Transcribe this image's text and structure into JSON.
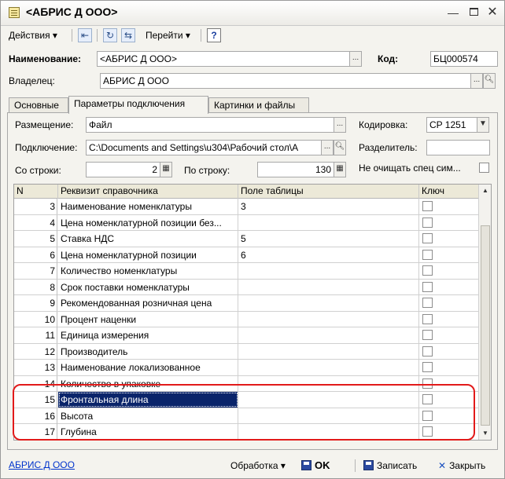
{
  "window": {
    "title": "<АБРИС Д ООО>"
  },
  "toolbar": {
    "actions_label": "Действия ▾",
    "goto_label": "Перейти ▾",
    "help_label": "?"
  },
  "header": {
    "name_label": "Наименование:",
    "name_value": "<АБРИС Д ООО>",
    "code_label": "Код:",
    "code_value": "БЦ000574",
    "owner_label": "Владелец:",
    "owner_value": "АБРИС Д ООО"
  },
  "tabs": [
    "Основные",
    "Параметры подключения",
    "Картинки и файлы"
  ],
  "params": {
    "placement_label": "Размещение:",
    "placement_value": "Файл",
    "encoding_label": "Кодировка:",
    "encoding_value": "CP 1251",
    "connection_label": "Подключение:",
    "connection_value": "C:\\Documents and Settings\\u304\\Рабочий стол\\А",
    "separator_label": "Разделитель:",
    "separator_value": "",
    "from_row_label": "Со строки:",
    "from_row_value": "2",
    "to_row_label": "По строку:",
    "to_row_value": "130",
    "no_clear_label": "Не очищать спец сим..."
  },
  "table": {
    "columns": [
      "N",
      "Реквизит справочника",
      "Поле таблицы",
      "Ключ"
    ],
    "rows": [
      {
        "n": "3",
        "attr": "Наименование номенклатуры",
        "field": "3"
      },
      {
        "n": "4",
        "attr": "Цена номенклатурной позиции без...",
        "field": ""
      },
      {
        "n": "5",
        "attr": "Ставка НДС",
        "field": "5"
      },
      {
        "n": "6",
        "attr": "Цена номенклатурной позиции",
        "field": "6"
      },
      {
        "n": "7",
        "attr": "Количество номенклатуры",
        "field": ""
      },
      {
        "n": "8",
        "attr": "Срок поставки номенклатуры",
        "field": ""
      },
      {
        "n": "9",
        "attr": "Рекомендованная розничная цена",
        "field": ""
      },
      {
        "n": "10",
        "attr": "Процент наценки",
        "field": ""
      },
      {
        "n": "11",
        "attr": "Единица измерения",
        "field": ""
      },
      {
        "n": "12",
        "attr": "Производитель",
        "field": ""
      },
      {
        "n": "13",
        "attr": "Наименование локализованное",
        "field": ""
      },
      {
        "n": "14",
        "attr": "Количество в упаковке",
        "field": ""
      },
      {
        "n": "15",
        "attr": "Фронтальная длина",
        "field": ""
      },
      {
        "n": "16",
        "attr": "Высота",
        "field": ""
      },
      {
        "n": "17",
        "attr": "Глубина",
        "field": ""
      }
    ]
  },
  "footer": {
    "owner_link": "АБРИС Д ООО",
    "processing_label": "Обработка ▾",
    "ok_label": "OK",
    "save_label": "Записать",
    "close_label": "Закрыть"
  }
}
